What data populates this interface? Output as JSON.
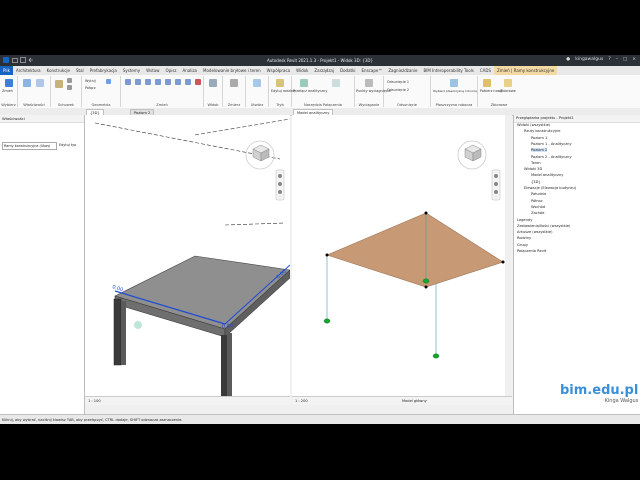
{
  "titlebar": {
    "title": "Autodesk Revit 2021.1.3 - Projekt1 - Widok 3D: {3D}",
    "user": "kingawalgus"
  },
  "tabs": [
    "Plik",
    "Architektura",
    "Konstrukcje",
    "Stal",
    "Prefabrykacja",
    "Systemy",
    "Wstaw",
    "Opisz",
    "Analiza",
    "Modelowanie bryłowe i teren",
    "Współpraca",
    "Widok",
    "Zarządzaj",
    "Dodatki",
    "Enscape™",
    "Zagnieżdżanie",
    "BIM Interoperability Tools",
    "CADS",
    "Zmień | Ramy konstrukcyjne"
  ],
  "ribbon": {
    "panels": [
      {
        "label": "Wybierz"
      },
      {
        "label": "Właściwości"
      },
      {
        "label": "Schowek"
      },
      {
        "label": "Geometria"
      },
      {
        "label": "Zmień"
      },
      {
        "label": "Widok"
      },
      {
        "label": "Zmierz"
      },
      {
        "label": "Utwórz"
      },
      {
        "label": "Tryb"
      },
      {
        "label": "Narzędzia Połączenia"
      },
      {
        "label": "Wyciąganie"
      },
      {
        "label": "Odsunięcie"
      },
      {
        "label": "Płaszczyzna robocza"
      },
      {
        "label": "Zbiorowe"
      }
    ],
    "buttons": {
      "modify": "Zmień",
      "cut": "Wytnij",
      "join": "Połącz",
      "edit_family": "Edytuj rodzinę",
      "analytical_node": "Przełącz analityczny",
      "analytical_joint": "Punkty wyciągnięcia",
      "offset1": "Odsunięcie 1",
      "offset2": "Odsunięcie 2",
      "workplane": "Wybierz płaszczyznę roboczą",
      "pick_new": "Pobierz nowy",
      "group": "Zbiorowe"
    }
  },
  "view_tabs": {
    "t1": "{3D}",
    "t2": "Poziom 2",
    "t3": "Model analityczny"
  },
  "properties": {
    "header": "Właściwości",
    "type": "Ramy konstrukcyjne (Ukos)",
    "edit_type": "Edytuj typ"
  },
  "view3d": {
    "dim1": "0.00",
    "dim2": "0.00",
    "dim3": "0.00",
    "scale": "1 : 100"
  },
  "view_analytical": {
    "scale": "1 : 200",
    "model": "Model główny"
  },
  "browser": {
    "header": "Przeglądarka projektu - Projekt1",
    "items": [
      {
        "label": "Widoki (wszystkie)",
        "level": 0
      },
      {
        "label": "Rzuty konstrukcyjne",
        "level": 1
      },
      {
        "label": "Poziom 1",
        "level": 2
      },
      {
        "label": "Poziom 1 - Analityczny",
        "level": 2
      },
      {
        "label": "Poziom 2",
        "level": 2
      },
      {
        "label": "Poziom 2 - Analityczny",
        "level": 2
      },
      {
        "label": "Teren",
        "level": 2
      },
      {
        "label": "Widoki 3D",
        "level": 1
      },
      {
        "label": "Model analityczny",
        "level": 2
      },
      {
        "label": "{3D}",
        "level": 2
      },
      {
        "label": "Elewacje (Elewacja budynku)",
        "level": 1
      },
      {
        "label": "Południe",
        "level": 2
      },
      {
        "label": "Północ",
        "level": 2
      },
      {
        "label": "Wschód",
        "level": 2
      },
      {
        "label": "Zachód",
        "level": 2
      },
      {
        "label": "Legendy",
        "level": 0
      },
      {
        "label": "Zestawienia/Ilości (wszystkie)",
        "level": 0
      },
      {
        "label": "Arkusze (wszystkie)",
        "level": 0
      },
      {
        "label": "Rodziny",
        "level": 0
      },
      {
        "label": "Grupy",
        "level": 0
      },
      {
        "label": "Połączenia Revit",
        "level": 0
      }
    ]
  },
  "statusbar": {
    "text": "Kliknij, aby wybrać, naciśnij klawisz TAB, aby przełączyć, CTRL dodaje, SHIFT odznacza zaznaczenie."
  },
  "brand": {
    "logo": "bim.edu.pl",
    "author": "Kinga Walgus"
  },
  "colors": {
    "file_tab": "#1565c0",
    "context_tab": "#f3d9a3",
    "slab_analytical": "#c79a75",
    "selection_blue": "#1e4bd1",
    "support_green": "#11a82d"
  }
}
